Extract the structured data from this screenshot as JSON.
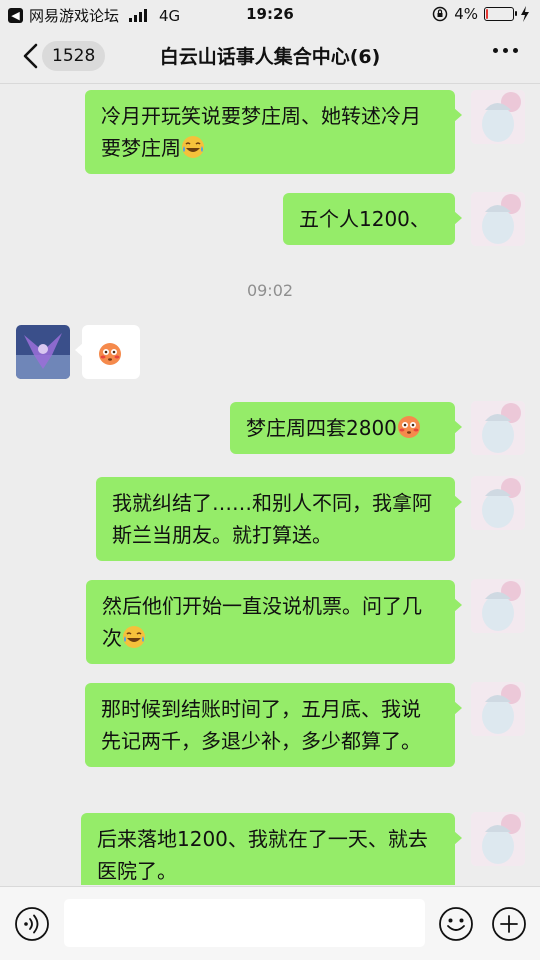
{
  "status_bar": {
    "carrier": "网易游戏论坛",
    "network": "4G",
    "time": "19:26",
    "battery": "4%",
    "battery_level": 0.04
  },
  "nav": {
    "unread_count": "1528",
    "title": "白云山话事人集合中心(6)"
  },
  "messages": [
    {
      "text": "冷月开玩笑说要梦庄周、她转述冷月要梦庄周"
    },
    {
      "text": "五个人1200、"
    },
    {
      "timestamp": "09:02"
    },
    {
      "emoji": "flushed-face"
    },
    {
      "text": "梦庄周四套2800"
    },
    {
      "text": "我就纠结了……和别人不同，我拿阿斯兰当朋友。就打算送。"
    },
    {
      "text": "然后他们开始一直没说机票。问了几次"
    },
    {
      "text": "那时候到结账时间了，五月底、我说先记两千，多退少补，多少都算了。"
    },
    {
      "text": "后来落地1200、我就在了一天、就去医院了。"
    }
  ],
  "colors": {
    "background": "#ededed",
    "my_bubble": "#95ec69",
    "other_bubble": "#ffffff",
    "timestamp": "#8f8f8f"
  }
}
